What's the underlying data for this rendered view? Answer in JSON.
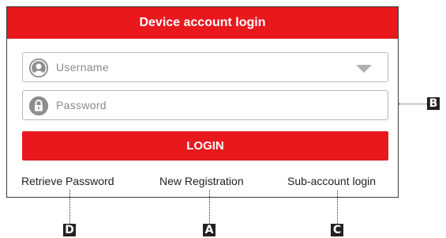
{
  "dialog": {
    "title": "Device account login",
    "username_placeholder": "Username",
    "password_placeholder": "Password",
    "login_label": "LOGIN",
    "links": {
      "retrieve_password": "Retrieve Password",
      "new_registration": "New Registration",
      "sub_account_login": "Sub-account login"
    }
  },
  "callouts": {
    "a": "A",
    "b": "B",
    "c": "C",
    "d": "D"
  },
  "colors": {
    "accent": "#e8181d",
    "icon_gray": "#8e8e8e",
    "field_border": "#b8b8b8"
  },
  "icons": {
    "username": "user-avatar-icon",
    "password": "padlock-icon",
    "dropdown": "dropdown-triangle-icon"
  }
}
